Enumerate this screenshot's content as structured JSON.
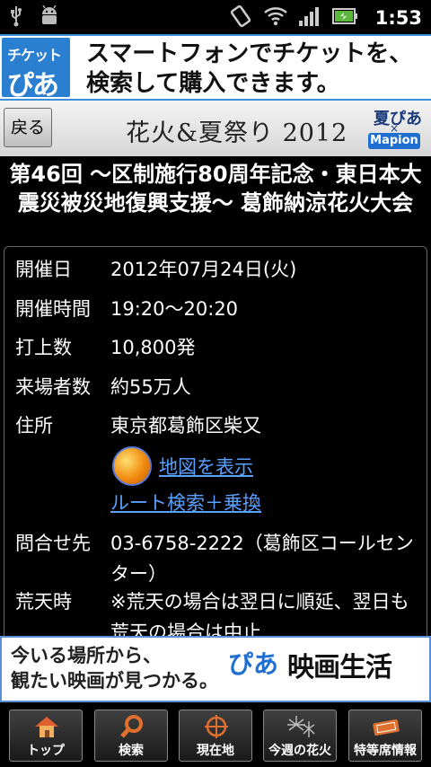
{
  "status_bar": {
    "time": "1:53"
  },
  "ad_top": {
    "logo_line1": "チケット",
    "logo_line2": "ぴあ",
    "line1": "スマートフォンでチケットを、",
    "line2": "検索して購入できます。"
  },
  "header": {
    "back_label": "戻る",
    "title": "花火&夏祭り 2012",
    "logo_top": "夏ぴあ",
    "logo_x": "×",
    "logo_bottom": "Mapion"
  },
  "event": {
    "title": "第46回 〜区制施行80周年記念・東日本大震災被災地復興支援〜 葛飾納涼花火大会"
  },
  "details": {
    "date_label": "開催日",
    "date_value": "2012年07月24日(火)",
    "time_label": "開催時間",
    "time_value": "19:20〜20:20",
    "launch_label": "打上数",
    "launch_value": "10,800発",
    "visitors_label": "来場者数",
    "visitors_value": "約55万人",
    "address_label": "住所",
    "address_value": "東京都葛飾区柴又",
    "map_link": "地図を表示",
    "route_link": "ルート検索＋乗換",
    "contact_label": "問合せ先",
    "contact_value": "03-6758-2222（葛飾区コールセンター）",
    "rain_label": "荒天時",
    "rain_value": "※荒天の場合は翌日に順延、翌日も荒天の場合は中止"
  },
  "ad_bottom": {
    "line1": "今いる場所から、",
    "line2": "観たい映画が見つかる。",
    "logo": "ぴあ",
    "title": "映画生活"
  },
  "nav": {
    "items": [
      {
        "label": "トップ",
        "icon": "home-icon"
      },
      {
        "label": "検索",
        "icon": "search-icon"
      },
      {
        "label": "現在地",
        "icon": "crosshair-icon"
      },
      {
        "label": "今週の花火",
        "icon": "fireworks-icon"
      },
      {
        "label": "特等席情報",
        "icon": "ticket-icon"
      }
    ]
  }
}
